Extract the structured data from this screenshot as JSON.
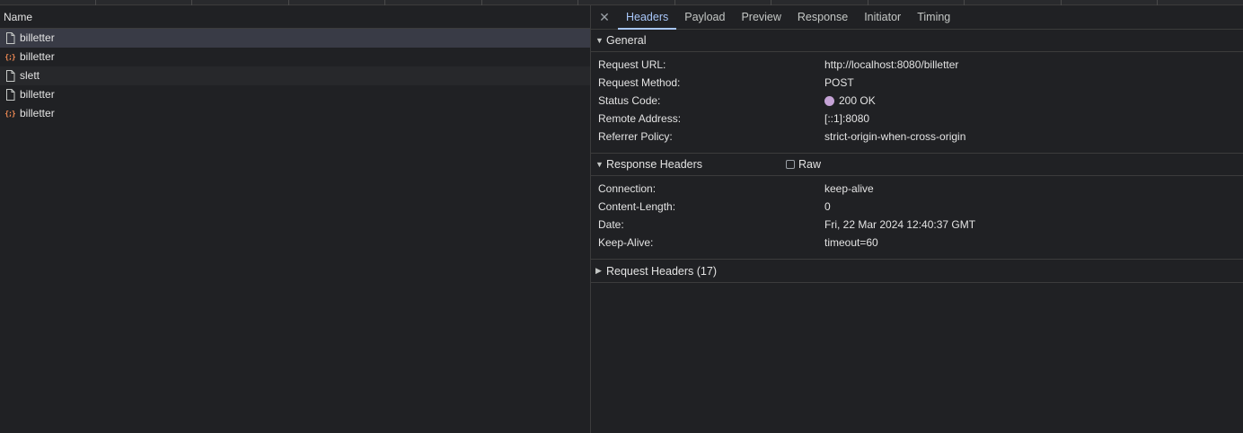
{
  "network": {
    "column_name": "Name",
    "requests": [
      {
        "name": "billetter",
        "icon": "document-icon",
        "state": "selected"
      },
      {
        "name": "billetter",
        "icon": "json-icon",
        "state": "normal"
      },
      {
        "name": "slett",
        "icon": "document-icon",
        "state": "alt"
      },
      {
        "name": "billetter",
        "icon": "document-icon",
        "state": "normal"
      },
      {
        "name": "billetter",
        "icon": "json-icon",
        "state": "normal"
      }
    ]
  },
  "details": {
    "close_glyph": "✕",
    "tabs": [
      {
        "label": "Headers",
        "active": true
      },
      {
        "label": "Payload",
        "active": false
      },
      {
        "label": "Preview",
        "active": false
      },
      {
        "label": "Response",
        "active": false
      },
      {
        "label": "Initiator",
        "active": false
      },
      {
        "label": "Timing",
        "active": false
      }
    ],
    "general": {
      "title": "General",
      "rows": [
        {
          "key": "Request URL:",
          "value": "http://localhost:8080/billetter"
        },
        {
          "key": "Request Method:",
          "value": "POST"
        },
        {
          "key": "Status Code:",
          "value": "200 OK"
        },
        {
          "key": "Remote Address:",
          "value": "[::1]:8080"
        },
        {
          "key": "Referrer Policy:",
          "value": "strict-origin-when-cross-origin"
        }
      ]
    },
    "response_headers": {
      "title": "Response Headers",
      "raw_label": "Raw",
      "rows": [
        {
          "key": "Connection:",
          "value": "keep-alive"
        },
        {
          "key": "Content-Length:",
          "value": "0"
        },
        {
          "key": "Date:",
          "value": "Fri, 22 Mar 2024 12:40:37 GMT"
        },
        {
          "key": "Keep-Alive:",
          "value": "timeout=60"
        }
      ]
    },
    "request_headers": {
      "title": "Request Headers (17)"
    }
  },
  "colors": {
    "background": "#202124",
    "active_tab": "#a8c7fa",
    "status_dot": "#c5a3d6",
    "json_icon": "#f28b54"
  }
}
